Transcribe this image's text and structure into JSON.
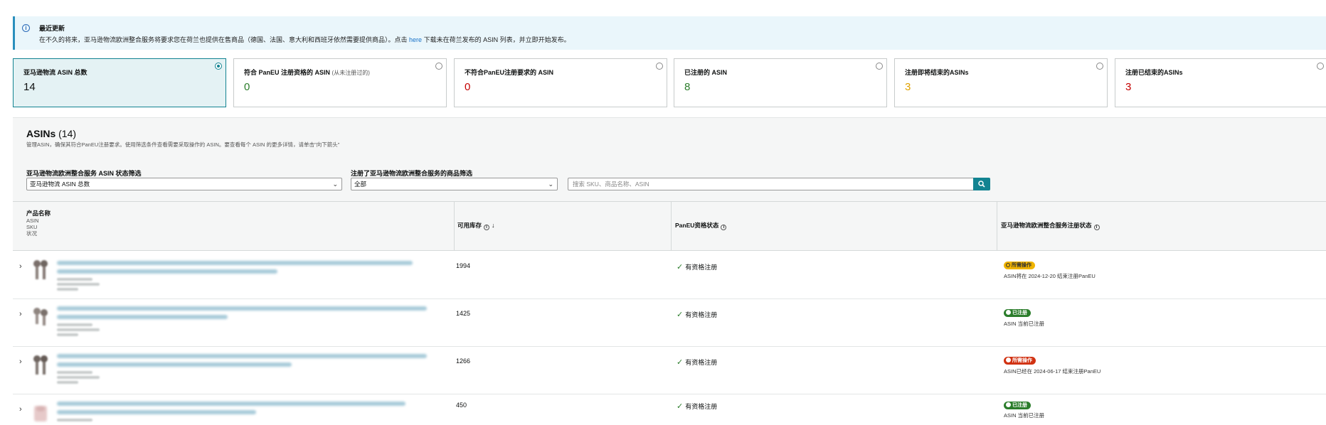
{
  "notice": {
    "title": "最近更新",
    "body_prefix": "在不久的将来，亚马逊物流欧洲整合服务将要求您在荷兰也提供在售商品（德国、法国、意大利和西班牙依然需要提供商品）。点击",
    "link": "here",
    "body_suffix": "下载未在荷兰发布的 ASIN 列表，并立即开始发布。"
  },
  "cards": [
    {
      "label": "亚马逊物流 ASIN 总数",
      "sub": "",
      "value": "14",
      "color": "#0f1111",
      "selected": true
    },
    {
      "label": "符合 PanEU 注册资格的 ASIN",
      "sub": "(从未注册过的)",
      "value": "0",
      "color": "#2b7d2b",
      "selected": false
    },
    {
      "label": "不符合PanEU注册要求的 ASIN",
      "sub": "",
      "value": "0",
      "color": "#c40000",
      "selected": false
    },
    {
      "label": "已注册的 ASIN",
      "sub": "",
      "value": "8",
      "color": "#2b7d2b",
      "selected": false
    },
    {
      "label": "注册即将结束的ASINs",
      "sub": "",
      "value": "3",
      "color": "#e0a200",
      "selected": false
    },
    {
      "label": "注册已结束的ASINs",
      "sub": "",
      "value": "3",
      "color": "#c40000",
      "selected": false
    }
  ],
  "section": {
    "title": "ASINs",
    "count": "(14)",
    "description": "管理ASIN，确保其符合PanEU注册要求。使用筛选条件查看需要采取操作的 ASIN。要查看每个 ASIN 的更多详情，请单击\"向下箭头\""
  },
  "filters": {
    "status_label": "亚马逊物流欧洲整合服务 ASIN 状态筛选",
    "status_value": "亚马逊物流 ASIN 总数",
    "registered_label": "注册了亚马逊物流欧洲整合服务的商品筛选",
    "registered_value": "全部",
    "search_placeholder": "搜索 SKU、商品名称、ASIN"
  },
  "table": {
    "headers": {
      "product": "产品名称",
      "product_sub": [
        "ASIN",
        "SKU",
        "状况"
      ],
      "stock": "可用库存",
      "paneu": "PanEU资格状态",
      "registration": "亚马逊物流欧洲整合服务注册状态"
    },
    "rows": [
      {
        "stock": "1994",
        "eligibility": "有资格注册",
        "badge": "所需操作",
        "badge_type": "warn",
        "status": "ASIN将在 2024-12-20 结束注册PanEU"
      },
      {
        "stock": "1425",
        "eligibility": "有资格注册",
        "badge": "已注册",
        "badge_type": "ok",
        "status": "ASIN 当前已注册"
      },
      {
        "stock": "1266",
        "eligibility": "有资格注册",
        "badge": "所需操作",
        "badge_type": "err",
        "status": "ASIN已经在 2024-06-17 结束注册PanEU"
      },
      {
        "stock": "450",
        "eligibility": "有资格注册",
        "badge": "已注册",
        "badge_type": "ok",
        "status": "ASIN 当前已注册"
      }
    ]
  }
}
